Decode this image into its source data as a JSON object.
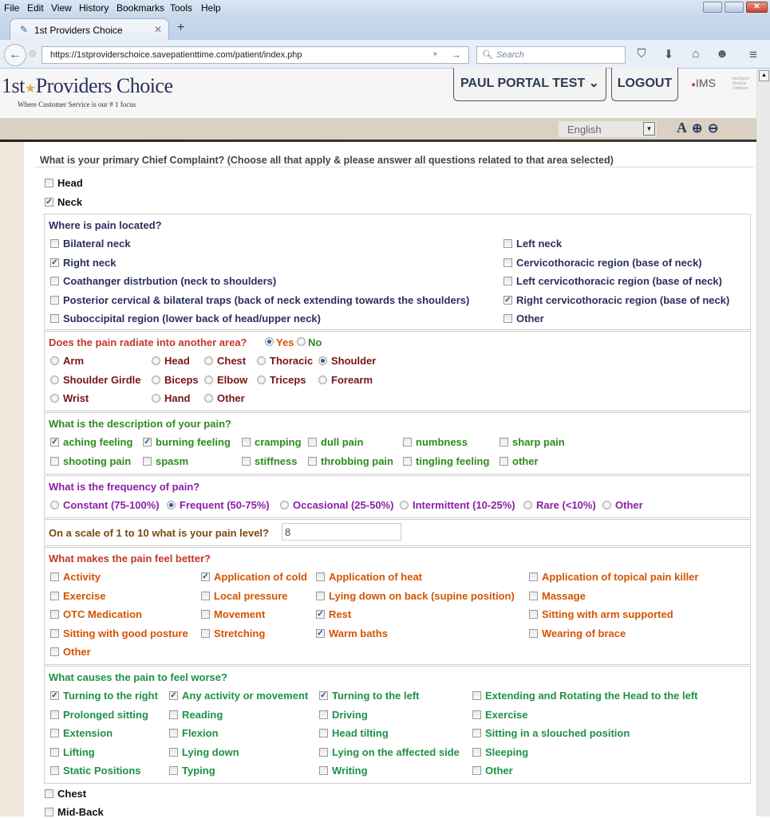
{
  "browser": {
    "menu": [
      "File",
      "Edit",
      "View",
      "History",
      "Bookmarks",
      "Tools",
      "Help"
    ],
    "tab_title": "1st Providers Choice",
    "url": "https://1stproviderschoice.savepatienttime.com/patient/index.php",
    "search_placeholder": "Search"
  },
  "header": {
    "logo_pre": "1st",
    "logo_main": "Providers Choice",
    "tagline": "Where Customer Service is our # 1 focus",
    "user_button": "PAUL PORTAL TEST ⌄",
    "logout": "LOGOUT",
    "ims": "IMS",
    "ims_sub": "Intelligent Medical Software",
    "language": "English",
    "font_a": "A"
  },
  "colors": {
    "navy": "#2a2f5e",
    "red": "#c0392b",
    "green": "#2e8b1f",
    "purple": "#8a1fa8",
    "olive": "#7a4b0f",
    "orange": "#d35400",
    "teal": "#1e9146"
  },
  "form": {
    "chief_question": "What is your primary Chief Complaint?    (Choose all that apply & please answer all questions related to that area selected)",
    "areas": [
      {
        "label": "Head",
        "checked": false
      },
      {
        "label": "Neck",
        "checked": true
      }
    ],
    "location": {
      "question": "Where is pain located?",
      "left": [
        {
          "label": "Bilateral neck",
          "checked": false
        },
        {
          "label": "Right neck",
          "checked": true
        },
        {
          "label": "Coathanger distrbution (neck to shoulders)",
          "checked": false
        },
        {
          "label": "Posterior cervical & bilateral traps (back of neck extending towards the shoulders)",
          "checked": false
        },
        {
          "label": "Suboccipital region (lower back of head/upper neck)",
          "checked": false
        }
      ],
      "right": [
        {
          "label": "Left neck",
          "checked": false
        },
        {
          "label": "Cervicothoracic region (base of neck)",
          "checked": false
        },
        {
          "label": "Left cervicothoracic region (base of neck)",
          "checked": false
        },
        {
          "label": "Right cervicothoracic region (base of neck)",
          "checked": true
        },
        {
          "label": "Other",
          "checked": false
        }
      ]
    },
    "radiate": {
      "question": "Does the pain radiate into another area?",
      "yes": "Yes",
      "no": "No",
      "answer": "Yes",
      "rows": [
        [
          {
            "label": "Arm",
            "checked": false
          },
          {
            "label": "Head",
            "checked": false
          },
          {
            "label": "Chest",
            "checked": false
          },
          {
            "label": "Thoracic",
            "checked": false
          },
          {
            "label": "Shoulder",
            "checked": true
          }
        ],
        [
          {
            "label": "Shoulder Girdle",
            "checked": false
          },
          {
            "label": "Biceps",
            "checked": false
          },
          {
            "label": "Elbow",
            "checked": false
          },
          {
            "label": "Triceps",
            "checked": false
          },
          {
            "label": "Forearm",
            "checked": false
          }
        ],
        [
          {
            "label": "Wrist",
            "checked": false
          },
          {
            "label": "Hand",
            "checked": false
          },
          {
            "label": "Other",
            "checked": false
          }
        ]
      ]
    },
    "description": {
      "question": "What is the description of your pain?",
      "rows": [
        [
          {
            "label": "aching feeling",
            "checked": true
          },
          {
            "label": "burning feeling",
            "checked": true
          },
          {
            "label": "cramping",
            "checked": false
          },
          {
            "label": "dull pain",
            "checked": false
          },
          {
            "label": "numbness",
            "checked": false
          },
          {
            "label": "sharp pain",
            "checked": false
          }
        ],
        [
          {
            "label": "shooting pain",
            "checked": false
          },
          {
            "label": "spasm",
            "checked": false
          },
          {
            "label": "stiffness",
            "checked": false
          },
          {
            "label": "throbbing pain",
            "checked": false
          },
          {
            "label": "tingling feeling",
            "checked": false
          },
          {
            "label": "other",
            "checked": false
          }
        ]
      ]
    },
    "frequency": {
      "question": "What is the frequency of pain?",
      "options": [
        {
          "label": "Constant (75-100%)",
          "checked": false
        },
        {
          "label": "Frequent (50-75%)",
          "checked": true
        },
        {
          "label": "Occasional (25-50%)",
          "checked": false
        },
        {
          "label": "Intermittent (10-25%)",
          "checked": false
        },
        {
          "label": "Rare (<10%)",
          "checked": false
        },
        {
          "label": "Other",
          "checked": false
        }
      ]
    },
    "pain_level": {
      "question": "On a scale of 1 to 10 what is your pain level?",
      "value": "8"
    },
    "better": {
      "question": "What makes the pain feel better?",
      "rows": [
        [
          {
            "label": "Activity",
            "checked": false
          },
          {
            "label": "Application of cold",
            "checked": true
          },
          {
            "label": "Application of heat",
            "checked": false
          },
          {
            "label": "Application of topical pain killer",
            "checked": false
          }
        ],
        [
          {
            "label": "Exercise",
            "checked": false
          },
          {
            "label": "Local pressure",
            "checked": false
          },
          {
            "label": "Lying down on back (supine position)",
            "checked": false
          },
          {
            "label": "Massage",
            "checked": false
          }
        ],
        [
          {
            "label": "OTC Medication",
            "checked": false
          },
          {
            "label": "Movement",
            "checked": false
          },
          {
            "label": "Rest",
            "checked": true
          },
          {
            "label": "Sitting with arm supported",
            "checked": false
          }
        ],
        [
          {
            "label": "Sitting with good posture",
            "checked": false
          },
          {
            "label": "Stretching",
            "checked": false
          },
          {
            "label": "Warm baths",
            "checked": true
          },
          {
            "label": "Wearing of brace",
            "checked": false
          }
        ],
        [
          {
            "label": "Other",
            "checked": false
          }
        ]
      ]
    },
    "worse": {
      "question": "What causes the pain to feel worse?",
      "rows": [
        [
          {
            "label": "Turning to the right",
            "checked": true
          },
          {
            "label": "Any activity or movement",
            "checked": true
          },
          {
            "label": "Turning to the left",
            "checked": true
          },
          {
            "label": "Extending and Rotating the Head to the left",
            "checked": false
          }
        ],
        [
          {
            "label": "Prolonged sitting",
            "checked": false
          },
          {
            "label": "Reading",
            "checked": false
          },
          {
            "label": "Driving",
            "checked": false
          },
          {
            "label": "Exercise",
            "checked": false
          }
        ],
        [
          {
            "label": "Extension",
            "checked": false
          },
          {
            "label": "Flexion",
            "checked": false
          },
          {
            "label": "Head tilting",
            "checked": false
          },
          {
            "label": "Sitting in a slouched position",
            "checked": false
          }
        ],
        [
          {
            "label": "Lifting",
            "checked": false
          },
          {
            "label": "Lying down",
            "checked": false
          },
          {
            "label": "Lying on the affected side",
            "checked": false
          },
          {
            "label": "Sleeping",
            "checked": false
          }
        ],
        [
          {
            "label": "Static Positions",
            "checked": false
          },
          {
            "label": "Typing",
            "checked": false
          },
          {
            "label": "Writing",
            "checked": false
          },
          {
            "label": "Other",
            "checked": false
          }
        ]
      ]
    },
    "more_areas": [
      {
        "label": "Chest",
        "checked": false
      },
      {
        "label": "Mid-Back",
        "checked": false
      }
    ]
  }
}
